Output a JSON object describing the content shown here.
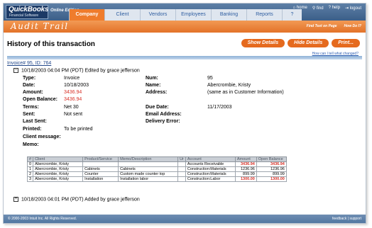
{
  "brand": {
    "line1": "QuickBooks",
    "line2": "Financial Software",
    "edition": "Online Edition"
  },
  "nav": {
    "tabs": [
      "Company",
      "Client",
      "Vendors",
      "Employees",
      "Banking",
      "Reports",
      "?"
    ],
    "active": "Company"
  },
  "utility": {
    "home": "home",
    "find": "find",
    "help": "help",
    "logout": "logout"
  },
  "audit": {
    "title": "Audit Trail",
    "find_text": "Find Text on Page",
    "how_do_i": "How Do I?"
  },
  "page": {
    "title": "History of this transaction",
    "show_details": "Show Details",
    "hide_details": "Hide Details",
    "print": "Print...",
    "help_link": "How can I tell what changed?",
    "invoice_link": "Invoice# 95, ID: 764"
  },
  "entry1": {
    "toggle": "−",
    "summary": "10/18/2003 04:04 PM (PDT) Edited by grace jefferson",
    "type_label": "Type:",
    "type": "Invoice",
    "date_label": "Date:",
    "date": "10/18/2003",
    "amount_label": "Amount:",
    "amount": "3436.94",
    "open_balance_label": "Open Balance:",
    "open_balance": "3436.94",
    "terms_label": "Terms:",
    "terms": "Net 30",
    "sent_label": "Sent:",
    "sent": "Not sent",
    "last_sent_label": "Last Sent:",
    "printed_label": "Printed:",
    "printed": "To be printed",
    "client_message_label": "Client message:",
    "memo_label": "Memo:",
    "num_label": "Num:",
    "num": "95",
    "name_label": "Name:",
    "name": "Abercrombie, Kristy",
    "address_label": "Address:",
    "address": "(same as in Customer Information)",
    "due_date_label": "Due Date:",
    "due_date": "11/17/2003",
    "email_label": "Email Address:",
    "delivery_error_label": "Delivery Error:"
  },
  "table": {
    "headers": [
      "#",
      "Client",
      "Product/Service",
      "Memo/Description",
      "Ur",
      "Account",
      "Amount",
      "Open Balance"
    ],
    "rows": [
      [
        "0",
        "Abercrombie, Kristy",
        "",
        "",
        "",
        "Accounts Receivable",
        "3436.94",
        "3436.94"
      ],
      [
        "1",
        "Abercrombie, Kristy",
        "Cabinets",
        "Cabinets",
        "",
        "Construction:Materials",
        "1236.96",
        "1236.96"
      ],
      [
        "2",
        "Abercrombie, Kristy",
        "Counter",
        "Custom made counter top",
        "",
        "Construction:Materials",
        "899.99",
        "899.99"
      ],
      [
        "3",
        "Abercrombie, Kristy",
        "Installation",
        "Installation labor",
        "",
        "Construction:Labor",
        "1300.00",
        "1300.00"
      ]
    ]
  },
  "entry2": {
    "toggle": "+",
    "summary": "10/18/2003 04:01 PM (PDT) Added by grace jefferson"
  },
  "footer": {
    "copyright": "© 2000-2003 Intuit Inc. All Rights Reserved.",
    "feedback": "feedback",
    "support": "support"
  }
}
